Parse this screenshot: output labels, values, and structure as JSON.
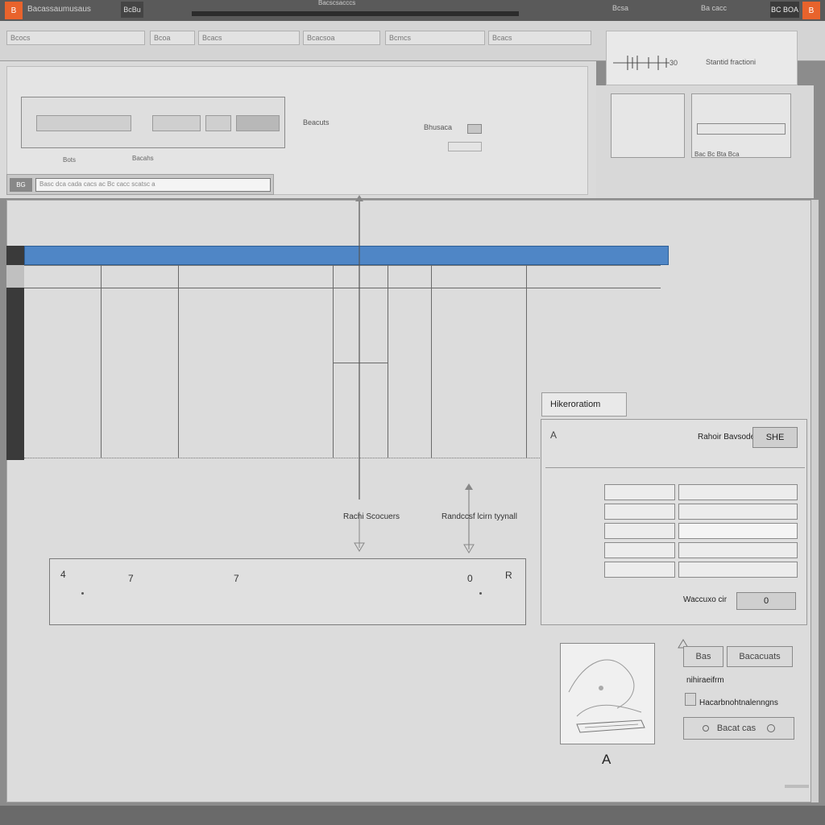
{
  "window": {
    "app_badge": "B",
    "title": "Bacassaumusaus",
    "tab": "BcBu",
    "center_title": "Bacscsacccs",
    "right_1": "Bcsa",
    "right_2": "Ba cacc",
    "right_3": "BC BOA",
    "close_badge": "B"
  },
  "toolbar": {
    "items": [
      "Bcocs",
      "Bcoa",
      "Bcacs",
      "Bcacsoa",
      "Bcmcs",
      "Bcacs"
    ]
  },
  "preview": {
    "code": "30",
    "label": "Stantid fractioni"
  },
  "dock": {
    "ruler_label": "Beacuts",
    "ruler_button": "Bhusaca",
    "left_caption": "Bots",
    "left_caption_2": "Bacahs",
    "search_prefix": "BG",
    "search_placeholder": "Basc dca cada cacs ac Bc cacc scatsc a"
  },
  "right_nav": {
    "caption": "Bac Bc Bta Bca"
  },
  "canvas": {
    "arrow_label_1": "Rachi Scocuers",
    "arrow_label_2": "Randccsf lcirn tyynall"
  },
  "info_strip": {
    "values": [
      "4",
      "7",
      "7",
      "0",
      "R"
    ]
  },
  "properties": {
    "tab_label": "Hikeroratiom",
    "corner_label": "A",
    "field_label": "Rahoir Bavsode",
    "field_button": "SHE",
    "value_label": "Waccuxo cir",
    "value": "0"
  },
  "image": {
    "caption": "A"
  },
  "side": {
    "button_top_1": "Bas",
    "button_top_2": "Bacacuats",
    "label_1": "nihiraeifrm",
    "label_2": "Hacarbnohtnalenngns",
    "button_bottom": "Bacat cas"
  },
  "colors": {
    "accent_orange": "#e8632c",
    "selection_blue": "#4f86c6"
  }
}
